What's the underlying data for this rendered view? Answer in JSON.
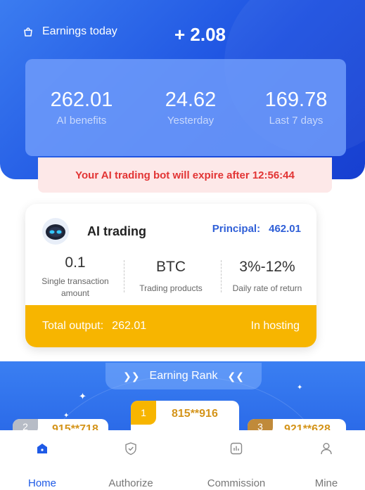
{
  "header": {
    "earnings_label": "Earnings today",
    "earnings_value": "+ 2.08",
    "icon": "bag-icon"
  },
  "stats": [
    {
      "value": "262.01",
      "label": "AI benefits"
    },
    {
      "value": "24.62",
      "label": "Yesterday"
    },
    {
      "value": "169.78",
      "label": "Last 7 days"
    }
  ],
  "expire_notice": "Your AI trading bot will expire after 12:56:44",
  "ai_card": {
    "title": "AI trading",
    "principal_label": "Principal:",
    "principal_value": "462.01",
    "metrics": [
      {
        "value": "0.1",
        "label": "Single transaction amount"
      },
      {
        "value": "BTC",
        "label": "Trading products"
      },
      {
        "value": "3%-12%",
        "label": "Daily rate of return"
      }
    ],
    "footer": {
      "label": "Total output:",
      "value": "262.01",
      "status": "In hosting"
    }
  },
  "rank": {
    "title": "Earning Rank",
    "podium": [
      {
        "rank": "1",
        "name": "815**916"
      },
      {
        "rank": "2",
        "name": "915**718"
      },
      {
        "rank": "3",
        "name": "921**628"
      }
    ]
  },
  "tabs": [
    {
      "label": "Home",
      "icon": "home-icon",
      "active": true
    },
    {
      "label": "Authorize",
      "icon": "shield-check-icon"
    },
    {
      "label": "Commission",
      "icon": "chart-icon"
    },
    {
      "label": "Mine",
      "icon": "user-icon"
    }
  ],
  "colors": {
    "primary": "#1e5ae6",
    "warning": "#e23434",
    "gold": "#f7b500"
  }
}
